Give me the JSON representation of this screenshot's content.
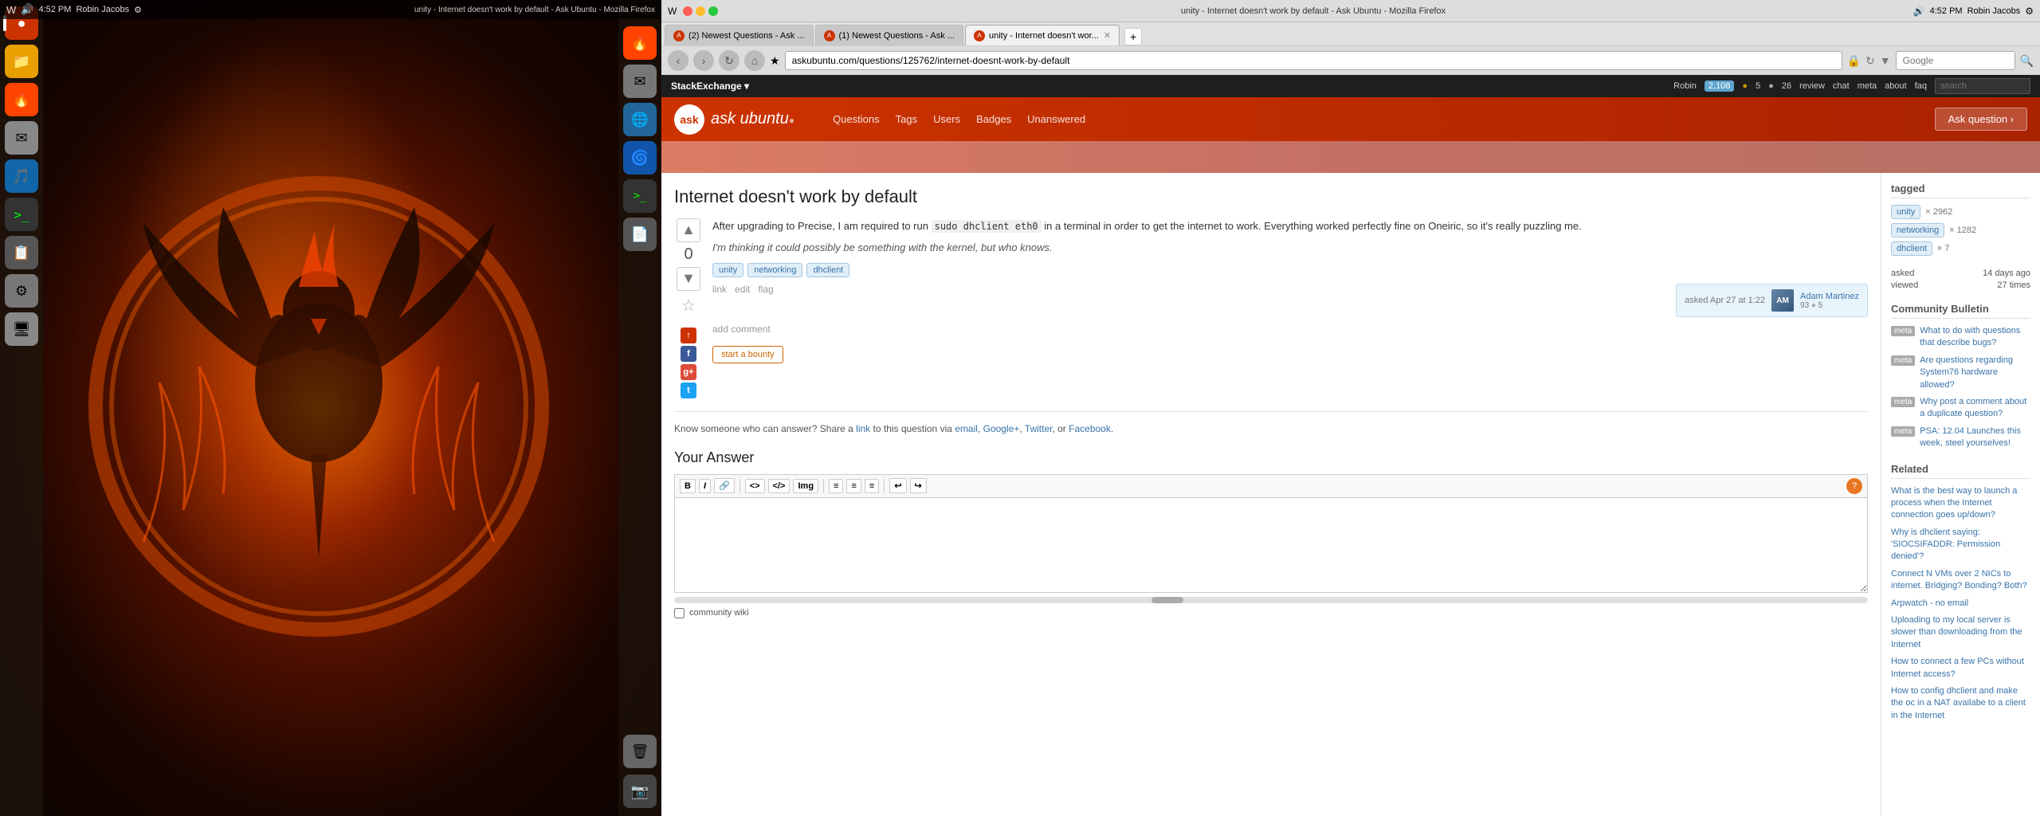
{
  "desktop": {
    "taskbar": {
      "time": "4:52 PM",
      "user": "Robin Jacobs",
      "window_title": "unity - Internet doesn't work by default - Ask Ubuntu - Mozilla Firefox"
    },
    "dock_items": [
      {
        "icon": "🔴",
        "label": "Ubuntu Home"
      },
      {
        "icon": "📁",
        "label": "Files"
      },
      {
        "icon": "🦊",
        "label": "Firefox"
      },
      {
        "icon": "📧",
        "label": "Thunderbird"
      },
      {
        "icon": "🌀",
        "label": "Rhythmbox"
      },
      {
        "icon": "💻",
        "label": "Terminal"
      },
      {
        "icon": "📋",
        "label": "Clipboard"
      },
      {
        "icon": "⚙️",
        "label": "Settings"
      },
      {
        "icon": "🖥",
        "label": "Files2"
      }
    ]
  },
  "browser": {
    "titlebar": {
      "text": "unity - Internet doesn't work by default - Ask Ubuntu - Mozilla Firefox",
      "icons": [
        "W",
        "🔊"
      ]
    },
    "tabs": [
      {
        "label": "(2) Newest Questions - Ask ...",
        "active": false
      },
      {
        "label": "(1) Newest Questions - Ask ...",
        "active": false
      },
      {
        "label": "unity - Internet doesn't wor...",
        "active": true
      }
    ],
    "address": "askubuntu.com/questions/125762/internet-doesnt-work-by-default",
    "search_placeholder": "Google",
    "nav": {
      "back": "‹",
      "forward": "›",
      "refresh": "↻",
      "home": "⌂"
    }
  },
  "stackexchange": {
    "topbar": {
      "brand": "StackExchange",
      "user": "Robin",
      "rep": "2,108",
      "gold": "5",
      "silver": "26",
      "links": [
        "review",
        "chat",
        "meta",
        "about",
        "faq"
      ],
      "search_placeholder": "search"
    },
    "site": {
      "name": "ask ubuntu",
      "nav": [
        "Questions",
        "Tags",
        "Users",
        "Badges",
        "Unanswered"
      ],
      "ask_btn": "Ask question ›"
    }
  },
  "question": {
    "title": "Internet doesn't work by default",
    "vote_count": "0",
    "body_p1": "After upgrading to Precise, I am required to run 'sudo dhclient eth0' in a terminal in order to get the internet to work. Everything worked perfectly fine on Oneiric, so it's really puzzling me.",
    "body_p2": "I'm thinking it could possibly be something with the kernel, but who knows.",
    "tags": [
      "unity",
      "networking",
      "dhclient"
    ],
    "actions": [
      "link",
      "edit",
      "flag"
    ],
    "asked_date": "asked Apr 27 at 1:22",
    "user_name": "Adam Martinez",
    "user_rep": "93",
    "user_badges": "5",
    "add_comment": "add comment",
    "start_bounty": "start a bounty",
    "share_text": "Know someone who can answer? Share a",
    "share_link": "link",
    "share_via": "to this question via",
    "share_email": "email",
    "share_googleplus": "Google+",
    "share_twitter": "Twitter",
    "share_facebook": "Facebook"
  },
  "answer_editor": {
    "title": "Your Answer",
    "toolbar_buttons": [
      "B",
      "I",
      "🔗",
      "<>",
      "</> ",
      "Img"
    ],
    "toolbar_lists": [
      "≡",
      "≡",
      "≡"
    ],
    "toolbar_undo": [
      "↩",
      "↪"
    ],
    "community_wiki": "community wiki"
  },
  "sidebar": {
    "tagged_title": "tagged",
    "tags": [
      {
        "name": "unity",
        "count": "× 2962"
      },
      {
        "name": "networking",
        "count": "× 1282"
      },
      {
        "name": "dhclient",
        "count": "× 7"
      }
    ],
    "asked_title": "asked",
    "asked_date": "14 days ago",
    "viewed_label": "viewed",
    "viewed_count": "27 times",
    "community_bulletin_title": "Community Bulletin",
    "bulletin_items": [
      {
        "type": "meta",
        "text": "What to do with questions that describe bugs?"
      },
      {
        "type": "meta",
        "text": "Are questions regarding System76 hardware allowed?"
      },
      {
        "type": "meta",
        "text": "Why post a comment about a duplicate question?"
      },
      {
        "type": "meta",
        "text": "PSA: 12.04 Launches this week, steel yourselves!"
      }
    ],
    "related_title": "Related",
    "related_items": [
      {
        "text": "What is the best way to launch a process when the Internet connection goes up/down?"
      },
      {
        "text": "Why is dhclient saying: 'SIOCSIFADDR: Permission denied'?"
      },
      {
        "text": "Connect N VMs over 2 NICs to internet. Bridging? Bonding? Both?"
      },
      {
        "text": "Arpwatch - no email"
      },
      {
        "text": "Uploading to my local server is slower than downloading from the Internet"
      },
      {
        "text": "How to connect a few PCs without Internet access?"
      },
      {
        "text": "How to config dhclient and make the oc in a NAT availabe to a client in the Internet"
      }
    ]
  }
}
